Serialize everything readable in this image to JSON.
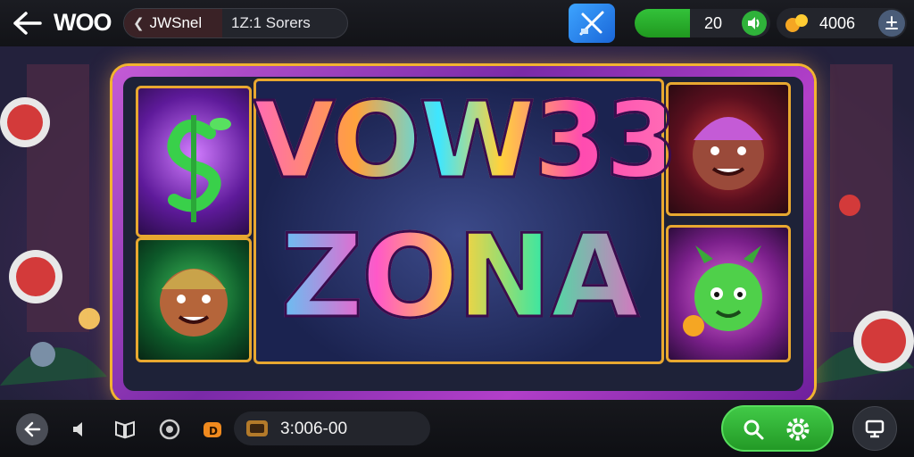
{
  "header": {
    "title": "WOO",
    "channel_chip": {
      "name": "JWSnel",
      "players": "1Z:1 Sorers"
    },
    "stat_value": "20",
    "coins": "4006"
  },
  "game": {
    "logo_line1": "VOW33",
    "logo_line2": "ZONA"
  },
  "footer": {
    "balance": "3:006-00"
  },
  "icons": {
    "back": "back-arrow-icon",
    "tool": "tool-icon",
    "speaker": "speaker-icon",
    "coin": "coin-icon",
    "menu": "menu-icon",
    "volume": "volume-icon",
    "book": "book-icon",
    "settings": "target-icon",
    "bonus": "bonus-icon",
    "wallet": "wallet-icon",
    "search": "search-icon",
    "gear": "gear-icon",
    "screen": "screen-icon"
  },
  "colors": {
    "accent_green": "#2fb23a",
    "frame_gold": "#e8a830",
    "frame_purple": "#9b3fc0",
    "bar_bg": "#17181d"
  }
}
